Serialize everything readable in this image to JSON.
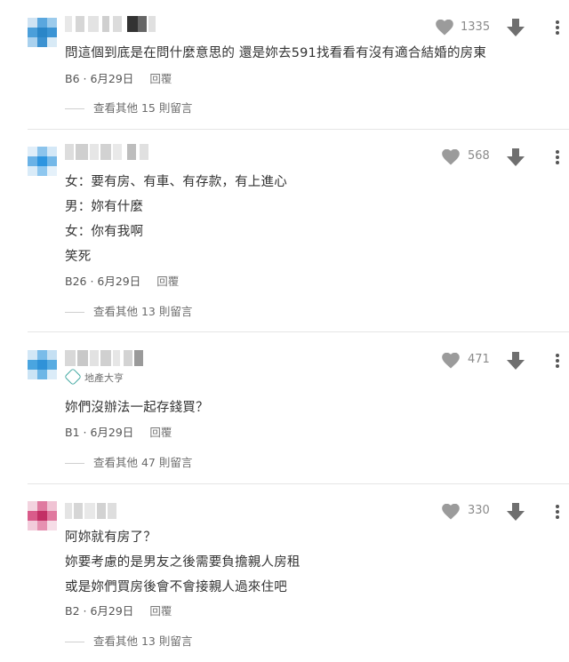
{
  "reply_label": "回覆",
  "comments": [
    {
      "likes": "1335",
      "lines": [
        "問這個到底是在問什麼意思的 還是妳去591找看看有沒有適合結婚的房東"
      ],
      "floor": "B6",
      "date": "6月29日",
      "more_replies": "查看其他 15 則留言",
      "avatar_color": "#3b8fd0"
    },
    {
      "likes": "568",
      "lines": [
        "女：要有房、有車、有存款，有上進心",
        "男：妳有什麼",
        "女：你有我啊",
        "笑死"
      ],
      "floor": "B26",
      "date": "6月29日",
      "more_replies": "查看其他 13 則留言",
      "avatar_color": "#3b9be0"
    },
    {
      "likes": "471",
      "badge": "地產大亨",
      "lines": [
        "妳們沒辦法一起存錢買？"
      ],
      "floor": "B1",
      "date": "6月29日",
      "more_replies": "查看其他 47 則留言",
      "avatar_color": "#3d9fd8"
    },
    {
      "likes": "330",
      "lines": [
        "阿妳就有房了？",
        "妳要考慮的是男友之後需要負擔親人房租",
        "或是妳們買房後會不會接親人過來住吧"
      ],
      "floor": "B2",
      "date": "6月29日",
      "more_replies": "查看其他 13 則留言",
      "avatar_color": "#c9366e"
    }
  ]
}
